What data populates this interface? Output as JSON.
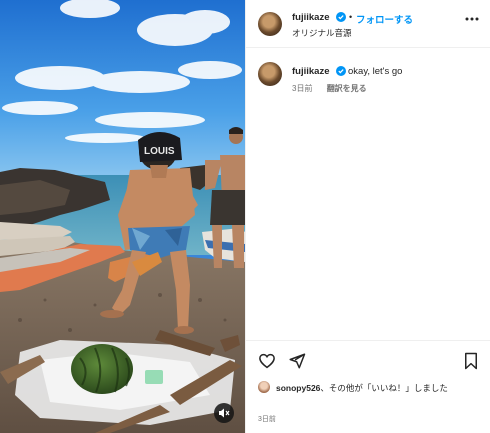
{
  "post": {
    "username": "fujiikaze",
    "follow_label": "フォローする",
    "separator": "•",
    "audio_label": "オリジナル音源",
    "more_icon": "more-options-icon"
  },
  "caption": {
    "username": "fujiikaze",
    "text": "okay, let's go",
    "age": "3日前",
    "translate_label": "翻訳を見る"
  },
  "media": {
    "hat_text": "LOUIS",
    "mute_icon": "speaker-muted-icon"
  },
  "actions": {
    "like_icon": "heart-icon",
    "share_icon": "send-icon",
    "save_icon": "bookmark-icon"
  },
  "likes": {
    "liker": "sonopy526",
    "rest": "、その他が「いいね！」しました"
  },
  "timestamp": "3日前",
  "colors": {
    "accent": "#0095f6",
    "verified": "#0095f6",
    "text": "#262626",
    "secondary": "#737373"
  }
}
